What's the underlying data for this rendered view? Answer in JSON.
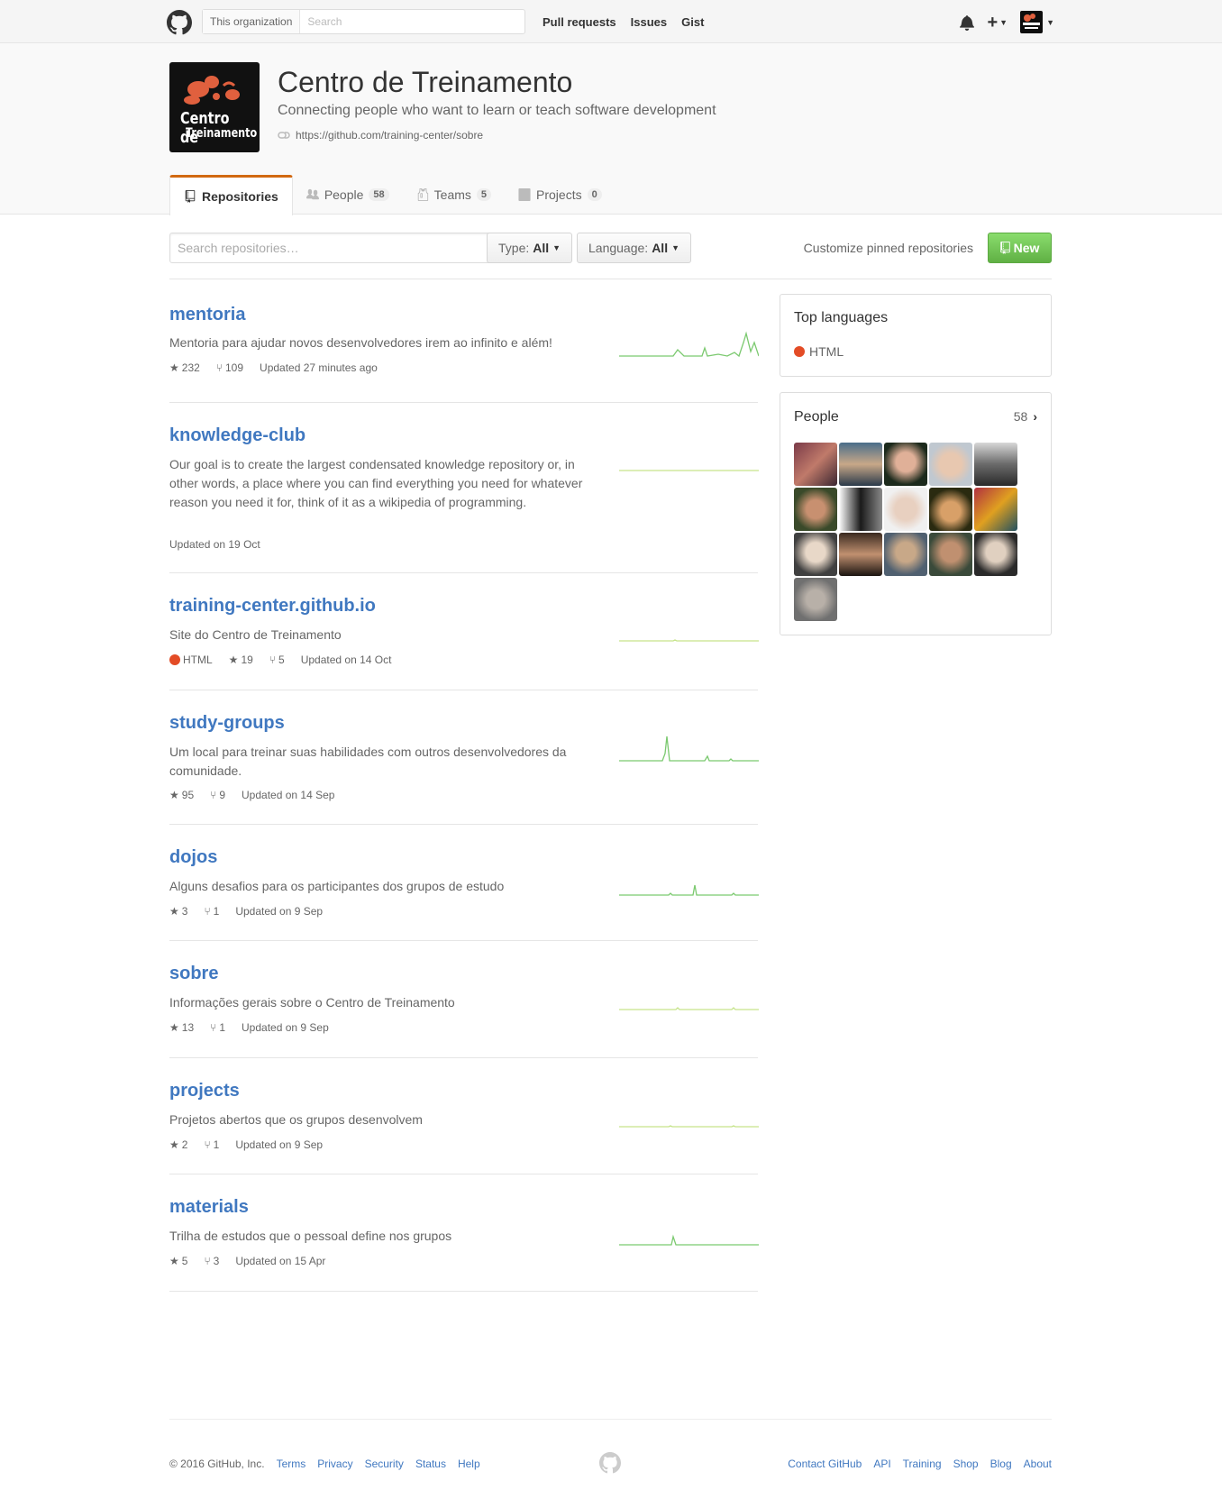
{
  "topbar": {
    "scope": "This organization",
    "search_placeholder": "Search",
    "nav": [
      "Pull requests",
      "Issues",
      "Gist"
    ]
  },
  "org": {
    "name": "Centro de Treinamento",
    "description": "Connecting people who want to learn or teach software development",
    "url": "https://github.com/training-center/sobre",
    "logo_line1": "Centro de",
    "logo_line2": "Treinamento"
  },
  "tabs": [
    {
      "label": "Repositories",
      "count": ""
    },
    {
      "label": "People",
      "count": "58"
    },
    {
      "label": "Teams",
      "count": "5"
    },
    {
      "label": "Projects",
      "count": "0"
    }
  ],
  "filters": {
    "search_placeholder": "Search repositories…",
    "type_label": "Type:",
    "type_value": "All",
    "language_label": "Language:",
    "language_value": "All",
    "pin_link": "Customize pinned repositories",
    "new_button": "New"
  },
  "repos": [
    {
      "name": "mentoria",
      "description": "Mentoria para ajudar novos desenvolvedores irem ao infinito e além!",
      "language": "",
      "stars": "232",
      "forks": "109",
      "updated": "Updated 27 minutes ago"
    },
    {
      "name": "knowledge-club",
      "description": "Our goal is to create the largest condensated knowledge repository or, in other words, a place where you can find everything you need for whatever reason you need it for, think of it as a wikipedia of programming.",
      "language": "",
      "stars": "",
      "forks": "",
      "updated": "Updated on 19 Oct"
    },
    {
      "name": "training-center.github.io",
      "description": "Site do Centro de Treinamento",
      "language": "HTML",
      "stars": "19",
      "forks": "5",
      "updated": "Updated on 14 Oct"
    },
    {
      "name": "study-groups",
      "description": "Um local para treinar suas habilidades com outros desenvolvedores da comunidade.",
      "language": "",
      "stars": "95",
      "forks": "9",
      "updated": "Updated on 14 Sep"
    },
    {
      "name": "dojos",
      "description": "Alguns desafios para os participantes dos grupos de estudo",
      "language": "",
      "stars": "3",
      "forks": "1",
      "updated": "Updated on 9 Sep"
    },
    {
      "name": "sobre",
      "description": "Informações gerais sobre o Centro de Treinamento",
      "language": "",
      "stars": "13",
      "forks": "1",
      "updated": "Updated on 9 Sep"
    },
    {
      "name": "projects",
      "description": "Projetos abertos que os grupos desenvolvem",
      "language": "",
      "stars": "2",
      "forks": "1",
      "updated": "Updated on 9 Sep"
    },
    {
      "name": "materials",
      "description": "Trilha de estudos que o pessoal define nos grupos",
      "language": "",
      "stars": "5",
      "forks": "3",
      "updated": "Updated on 15 Apr"
    }
  ],
  "sidebar": {
    "top_languages_title": "Top languages",
    "top_language": "HTML",
    "top_language_color": "#e34c26",
    "people_title": "People",
    "people_count": "58"
  },
  "footer": {
    "copyright": "© 2016 GitHub, Inc.",
    "left_links": [
      "Terms",
      "Privacy",
      "Security",
      "Status",
      "Help"
    ],
    "right_links": [
      "Contact GitHub",
      "API",
      "Training",
      "Shop",
      "Blog",
      "About"
    ]
  }
}
